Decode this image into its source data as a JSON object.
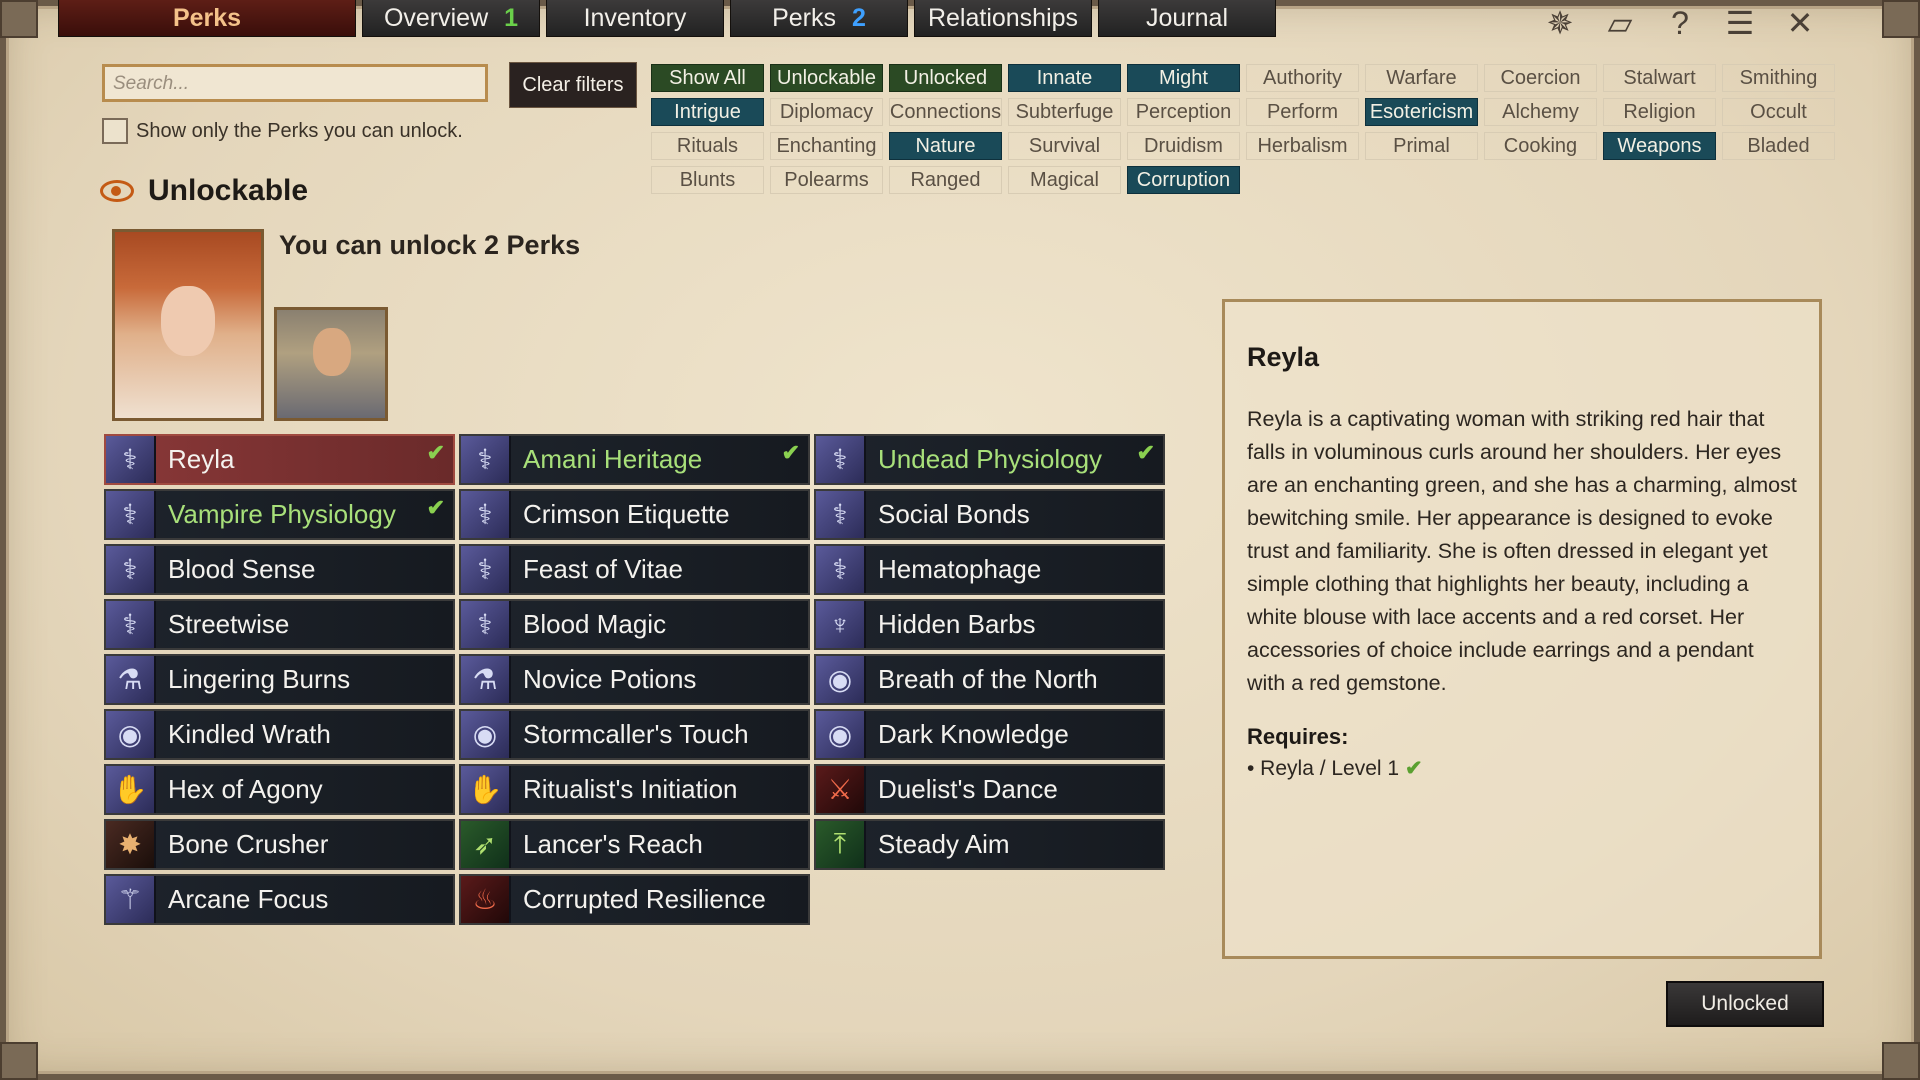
{
  "tabs": {
    "main": "Perks",
    "overview": "Overview",
    "overview_count": "1",
    "inventory": "Inventory",
    "perks": "Perks",
    "perks_count": "2",
    "relationships": "Relationships",
    "journal": "Journal"
  },
  "top_icons": [
    "banner-icon",
    "map-icon",
    "help-icon",
    "menu-icon",
    "close-icon"
  ],
  "search": {
    "placeholder": "Search...",
    "clear_label": "Clear filters",
    "only_unlockable": "Show only the Perks you can unlock."
  },
  "filters": [
    {
      "label": "Show All",
      "state": "green"
    },
    {
      "label": "Unlockable",
      "state": "green"
    },
    {
      "label": "Unlocked",
      "state": "green"
    },
    {
      "label": "Innate",
      "state": "teal"
    },
    {
      "label": "Might",
      "state": "teal"
    },
    {
      "label": "Authority",
      "state": "off"
    },
    {
      "label": "Warfare",
      "state": "off"
    },
    {
      "label": "Coercion",
      "state": "off"
    },
    {
      "label": "Stalwart",
      "state": "off"
    },
    {
      "label": "Smithing",
      "state": "off"
    },
    {
      "label": "Intrigue",
      "state": "teal"
    },
    {
      "label": "Diplomacy",
      "state": "off"
    },
    {
      "label": "Connections",
      "state": "off"
    },
    {
      "label": "Subterfuge",
      "state": "off"
    },
    {
      "label": "Perception",
      "state": "off"
    },
    {
      "label": "Perform",
      "state": "off"
    },
    {
      "label": "Esotericism",
      "state": "teal"
    },
    {
      "label": "Alchemy",
      "state": "off"
    },
    {
      "label": "Religion",
      "state": "off"
    },
    {
      "label": "Occult",
      "state": "off"
    },
    {
      "label": "Rituals",
      "state": "off"
    },
    {
      "label": "Enchanting",
      "state": "off"
    },
    {
      "label": "Nature",
      "state": "teal"
    },
    {
      "label": "Survival",
      "state": "off"
    },
    {
      "label": "Druidism",
      "state": "off"
    },
    {
      "label": "Herbalism",
      "state": "off"
    },
    {
      "label": "Primal",
      "state": "off"
    },
    {
      "label": "Cooking",
      "state": "off"
    },
    {
      "label": "Weapons",
      "state": "teal"
    },
    {
      "label": "Bladed",
      "state": "off"
    },
    {
      "label": "Blunts",
      "state": "off"
    },
    {
      "label": "Polearms",
      "state": "off"
    },
    {
      "label": "Ranged",
      "state": "off"
    },
    {
      "label": "Magical",
      "state": "off"
    },
    {
      "label": "Corruption",
      "state": "teal"
    }
  ],
  "section": {
    "title": "Unlockable",
    "unlock_text": "You can unlock 2 Perks"
  },
  "perks": [
    {
      "label": "Reyla",
      "icon": "dna-icon",
      "style": "",
      "unlocked": true,
      "selected": true
    },
    {
      "label": "Amani Heritage",
      "icon": "dna-icon",
      "style": "",
      "unlocked": true
    },
    {
      "label": "Undead Physiology",
      "icon": "dna-icon",
      "style": "",
      "unlocked": true
    },
    {
      "label": "Vampire Physiology",
      "icon": "dna-icon",
      "style": "",
      "unlocked": true
    },
    {
      "label": "Crimson Etiquette",
      "icon": "dna-icon",
      "style": ""
    },
    {
      "label": "Social Bonds",
      "icon": "dna-icon",
      "style": ""
    },
    {
      "label": "Blood Sense",
      "icon": "dna-icon",
      "style": ""
    },
    {
      "label": "Feast of Vitae",
      "icon": "dna-icon",
      "style": ""
    },
    {
      "label": "Hematophage",
      "icon": "dna-icon",
      "style": ""
    },
    {
      "label": "Streetwise",
      "icon": "dna-icon",
      "style": ""
    },
    {
      "label": "Blood Magic",
      "icon": "dna-icon",
      "style": ""
    },
    {
      "label": "Hidden Barbs",
      "icon": "kraken-icon",
      "style": ""
    },
    {
      "label": "Lingering Burns",
      "icon": "potion-icon",
      "style": ""
    },
    {
      "label": "Novice Potions",
      "icon": "potion-icon",
      "style": ""
    },
    {
      "label": "Breath of the North",
      "icon": "eye-icon",
      "style": ""
    },
    {
      "label": "Kindled Wrath",
      "icon": "eye-icon",
      "style": ""
    },
    {
      "label": "Stormcaller's Touch",
      "icon": "eye-icon",
      "style": ""
    },
    {
      "label": "Dark Knowledge",
      "icon": "eye-icon",
      "style": ""
    },
    {
      "label": "Hex of Agony",
      "icon": "ritual-hand-icon",
      "style": ""
    },
    {
      "label": "Ritualist's Initiation",
      "icon": "ritual-hand-icon",
      "style": ""
    },
    {
      "label": "Duelist's Dance",
      "icon": "sword-icon",
      "style": "red"
    },
    {
      "label": "Bone Crusher",
      "icon": "mace-icon",
      "style": "dark"
    },
    {
      "label": "Lancer's Reach",
      "icon": "spear-icon",
      "style": "green"
    },
    {
      "label": "Steady Aim",
      "icon": "bow-icon",
      "style": "green"
    },
    {
      "label": "Arcane Focus",
      "icon": "staff-icon",
      "style": ""
    },
    {
      "label": "Corrupted Resilience",
      "icon": "corruption-icon",
      "style": "red"
    }
  ],
  "detail": {
    "title": "Reyla",
    "description": "Reyla is a captivating woman with striking red hair that falls in voluminous curls around her shoulders. Her eyes are an enchanting green, and she has a charming, almost bewitching smile. Her appearance is designed to evoke trust and familiarity. She is often dressed in elegant yet simple clothing that highlights her beauty, including a white blouse with lace accents and a red corset. Her accessories of choice include earrings and a pendant with a red gemstone.",
    "requires_label": "Requires:",
    "requirement": "• Reyla / Level 1"
  },
  "status_button": "Unlocked"
}
